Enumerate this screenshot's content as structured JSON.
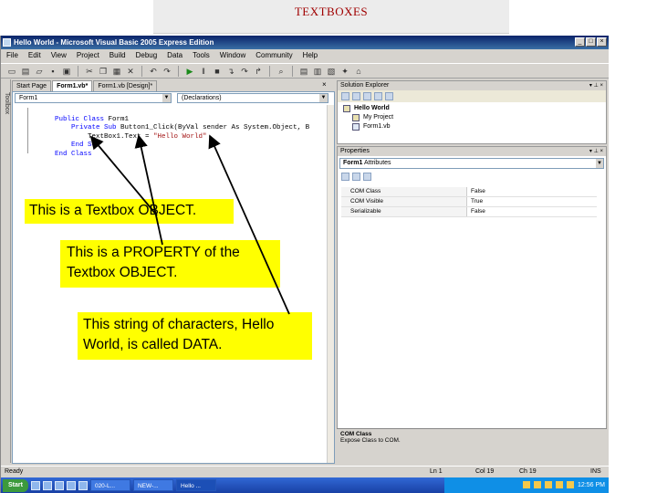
{
  "slide": {
    "title": "TEXTBOXES"
  },
  "window": {
    "title": "Hello World - Microsoft Visual Basic 2005 Express Edition",
    "controls": [
      "_",
      "□",
      "×"
    ]
  },
  "menu": [
    "File",
    "Edit",
    "View",
    "Project",
    "Build",
    "Debug",
    "Data",
    "Tools",
    "Window",
    "Community",
    "Help"
  ],
  "toolbox_label": "Toolbox",
  "doc_tabs": [
    "Start Page",
    "Form1.vb*",
    "Form1.vb [Design]*"
  ],
  "editor": {
    "object_combo": "Form1",
    "member_combo": "(Declarations)",
    "code": [
      {
        "kw": "Public Class",
        "rest": " Form1"
      },
      {
        "kw": "    Private Sub",
        "rest": " Button1_Click(ByVal sender As System.Object, B"
      },
      {
        "kw": "",
        "rest": "        TextBox1.Text = ",
        "str": "\"Hello World\""
      },
      {
        "kw": "    End Sub",
        "rest": ""
      },
      {
        "kw": "End Class",
        "rest": ""
      }
    ]
  },
  "solution_explorer": {
    "title": "Solution Explorer",
    "items": [
      "Hello World",
      "My Project",
      "Form1.vb"
    ]
  },
  "properties": {
    "title": "Properties",
    "object": "Form1",
    "object_type": "Attributes",
    "rows": [
      {
        "name": "COM Class",
        "value": "False"
      },
      {
        "name": "COM Visible",
        "value": "True"
      },
      {
        "name": "Serializable",
        "value": "False"
      }
    ],
    "description_title": "COM Class",
    "description_text": "Expose Class to COM."
  },
  "status": {
    "left": "Ready",
    "ln": "Ln 1",
    "col": "Col 19",
    "ch": "Ch 19",
    "mode": "INS"
  },
  "taskbar": {
    "start": "Start",
    "tasks": [
      "020-L...",
      "NEW-...",
      "Hello ..."
    ],
    "clock": "12:56 PM"
  },
  "callouts": {
    "object": "This is a Textbox OBJECT.",
    "property_line1": "This is a PROPERTY of the",
    "property_line2": "Textbox OBJECT.",
    "data_line1": "This string of characters, Hello",
    "data_line2": "World, is called DATA."
  },
  "colors": {
    "callout": "#ffff00",
    "title_text": "#a00000",
    "titlebar": "#0a246a"
  }
}
